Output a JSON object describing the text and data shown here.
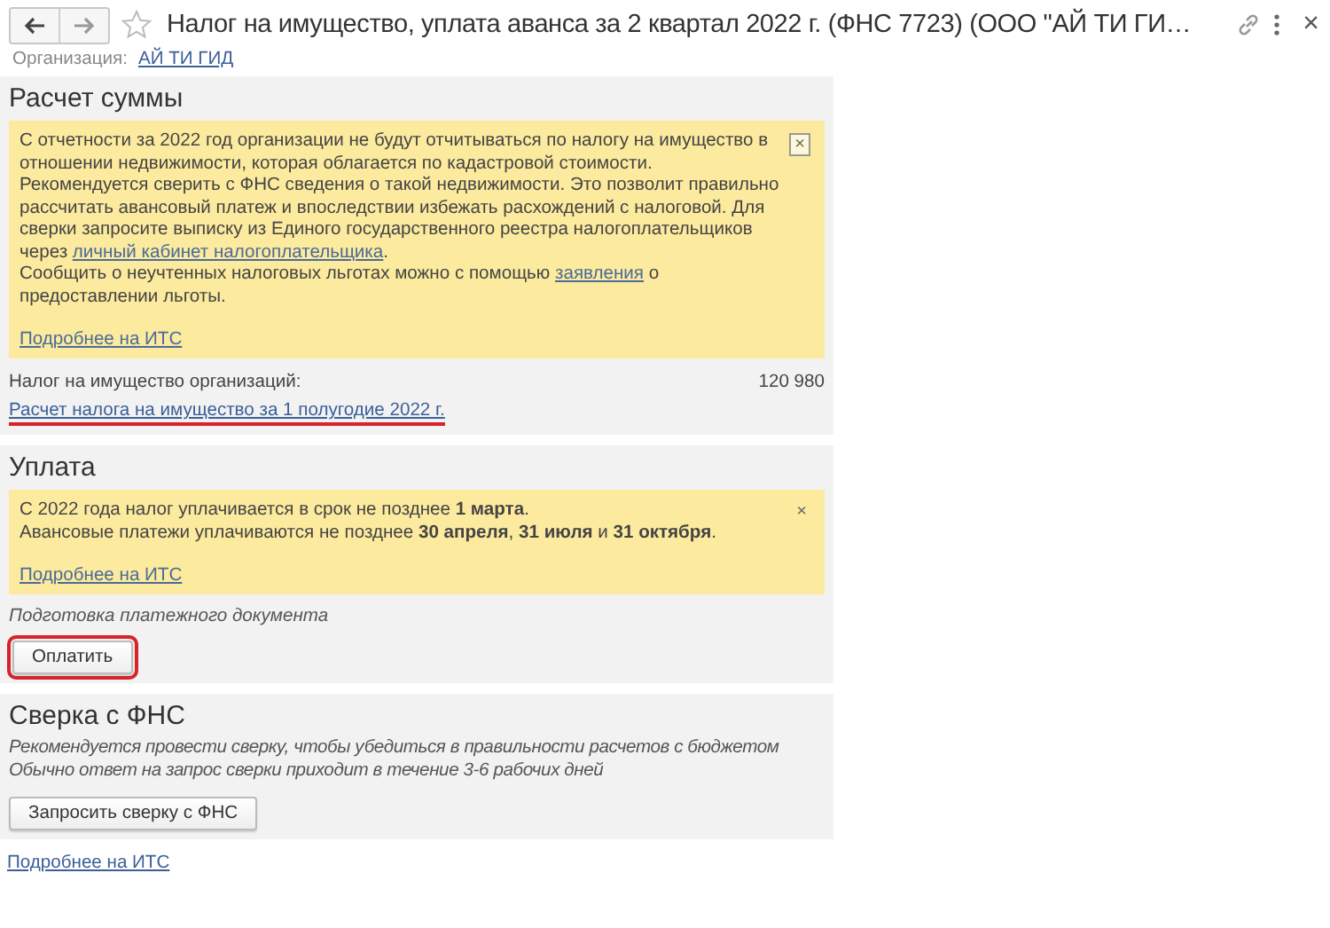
{
  "window": {
    "title": "Налог на имущество, уплата аванса за 2 квартал 2022 г. (ФНС 7723) (ООО \"АЙ ТИ ГИ…",
    "close": "×"
  },
  "organization": {
    "label": "Организация:",
    "value": "АЙ ТИ ГИД"
  },
  "sections": [
    {
      "kind": "calc",
      "title": "Расчет суммы",
      "notice": {
        "close": "×",
        "paragraphs": [
          [
            {
              "kind": "text",
              "text": "С отчетности за 2022 год организации не будут отчитываться по налогу на имущество в отношении недвижимости, которая облагается по кадастровой стоимости."
            }
          ],
          [
            {
              "kind": "text",
              "text": "Рекомендуется сверить с ФНС сведения о такой недвижимости. Это позволит правильно рассчитать авансовый платеж и впоследствии избежать расхождений с налоговой. Для сверки запросите выписку из  Единого государственного реестра налогоплательщиков через "
            },
            {
              "kind": "link",
              "text": "личный кабинет налогоплательщика"
            },
            {
              "kind": "text",
              "text": "."
            }
          ],
          [
            {
              "kind": "text",
              "text": "Сообщить о неучтенных налоговых льготах можно с помощью "
            },
            {
              "kind": "link",
              "text": "заявления"
            },
            {
              "kind": "text",
              "text": " о предоставлении льготы."
            }
          ]
        ],
        "more_link": "Подробнее на ИТС"
      },
      "amount": {
        "label": "Налог на имущество организаций:",
        "value": "120 980"
      },
      "link": {
        "text": "Расчет налога на имущество за 1 полугодие 2022 г.",
        "highlighted": true
      }
    },
    {
      "kind": "payment",
      "title": "Уплата",
      "notice": {
        "close": "×",
        "paragraphs": [
          [
            {
              "kind": "text",
              "text": "С 2022 года налог уплачивается в срок не позднее **1 марта**."
            }
          ],
          [
            {
              "kind": "text",
              "text": "Авансовые платежи уплачиваются не позднее **30 апреля**, **31 июля** и **31 октября**."
            }
          ]
        ],
        "more_link": "Подробнее на ИТС"
      },
      "caption": "Подготовка платежного документа",
      "button": {
        "label": "Оплатить",
        "highlighted": true
      }
    },
    {
      "kind": "reconcile",
      "title": "Сверка с ФНС",
      "notes": [
        "Рекомендуется провести сверку, чтобы убедиться в правильности расчетов с бюджетом",
        "Обычно ответ на запрос сверки приходит в течение 3-6 рабочих дней"
      ],
      "button": {
        "label": "Запросить сверку с ФНС",
        "highlighted": false
      }
    }
  ],
  "footer_link": "Подробнее на ИТС"
}
